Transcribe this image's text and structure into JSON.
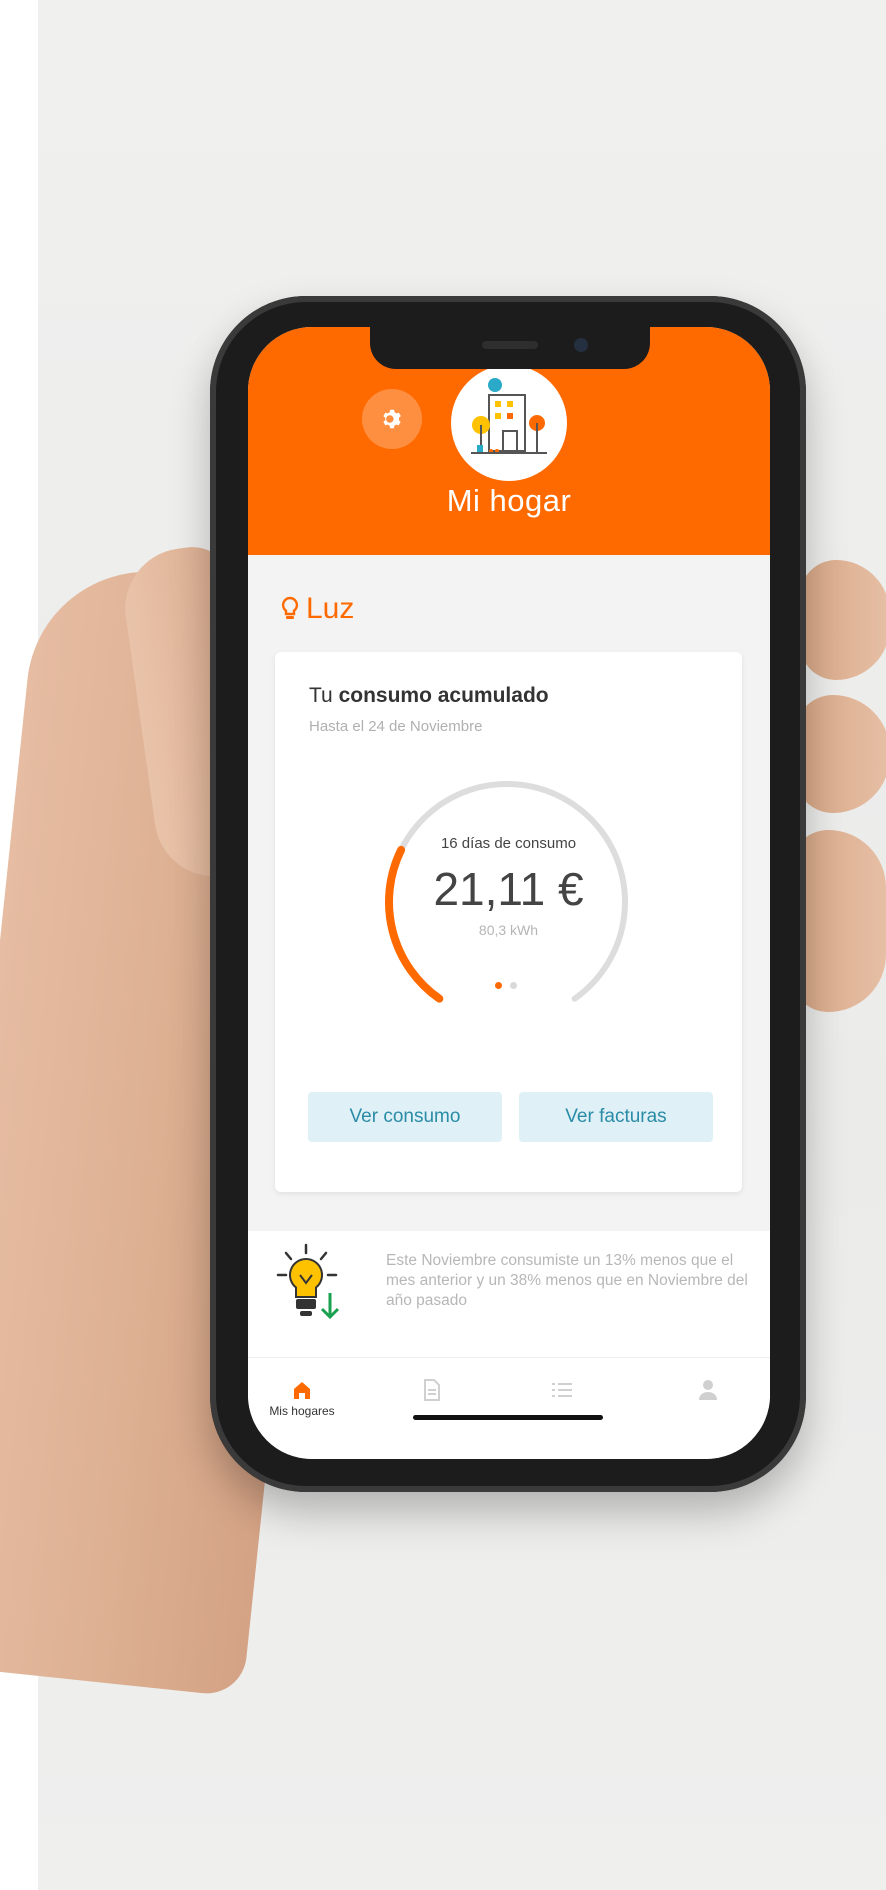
{
  "header": {
    "title": "Mi hogar",
    "brand_color": "#ff6a00"
  },
  "section": {
    "label": "Luz",
    "icon": "lightbulb-icon"
  },
  "consumption_card": {
    "title_prefix": "Tu ",
    "title_bold": "consumo acumulado",
    "subtitle": "Hasta el 24 de Noviembre",
    "days_label": "16 días de consumo",
    "amount": "21,11 €",
    "energy": "80,3 kWh",
    "progress_fraction": 0.28,
    "carousel_pages": 2,
    "carousel_active": 0,
    "buttons": {
      "consumption": "Ver consumo",
      "invoices": "Ver facturas"
    }
  },
  "tip": {
    "icon": "lightbulb-down-icon",
    "text": "Este Noviembre consumiste un 13% menos que el mes anterior y un 38% menos que en Noviembre del año pasado"
  },
  "tabbar": {
    "items": [
      {
        "label": "Mis hogares",
        "icon": "home-icon",
        "active": true
      },
      {
        "label": "",
        "icon": "document-icon",
        "active": false
      },
      {
        "label": "",
        "icon": "list-icon",
        "active": false
      },
      {
        "label": "",
        "icon": "user-icon",
        "active": false
      }
    ]
  }
}
